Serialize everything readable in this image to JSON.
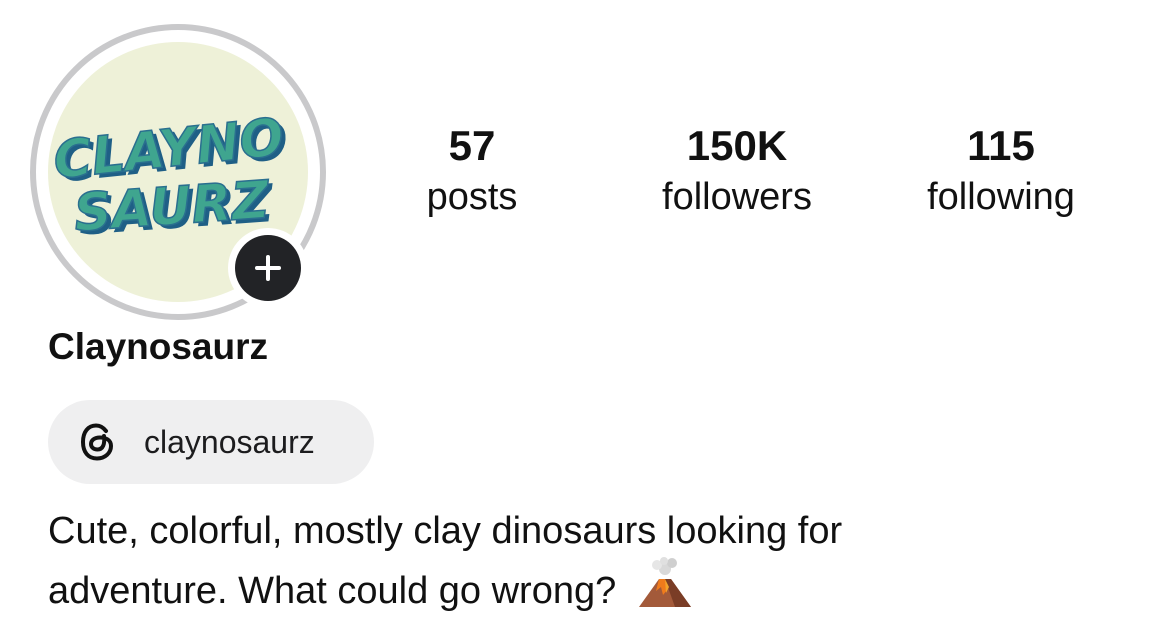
{
  "profile": {
    "avatar_logo_line1": "CLAYNO",
    "avatar_logo_line2": "SAURZ",
    "display_name": "Claynosaurz",
    "bio_line1": "Cute, colorful, mostly clay dinosaurs looking for",
    "bio_line2": "adventure. What could go wrong?",
    "bio_emoji": "volcano-icon"
  },
  "stats": {
    "posts": {
      "value": "57",
      "label": "posts"
    },
    "followers": {
      "value": "150K",
      "label": "followers"
    },
    "following": {
      "value": "115",
      "label": "following"
    }
  },
  "threads": {
    "handle": "claynosaurz",
    "icon": "threads-icon"
  },
  "add_story": {
    "icon": "plus-icon"
  },
  "colors": {
    "ring": "#c9c9cb",
    "avatar_bg": "#eef1d8",
    "logo_fill": "#3fa58f",
    "logo_shadow": "#1f5f86",
    "chip_bg": "#efeff0",
    "add_button": "#222326"
  }
}
